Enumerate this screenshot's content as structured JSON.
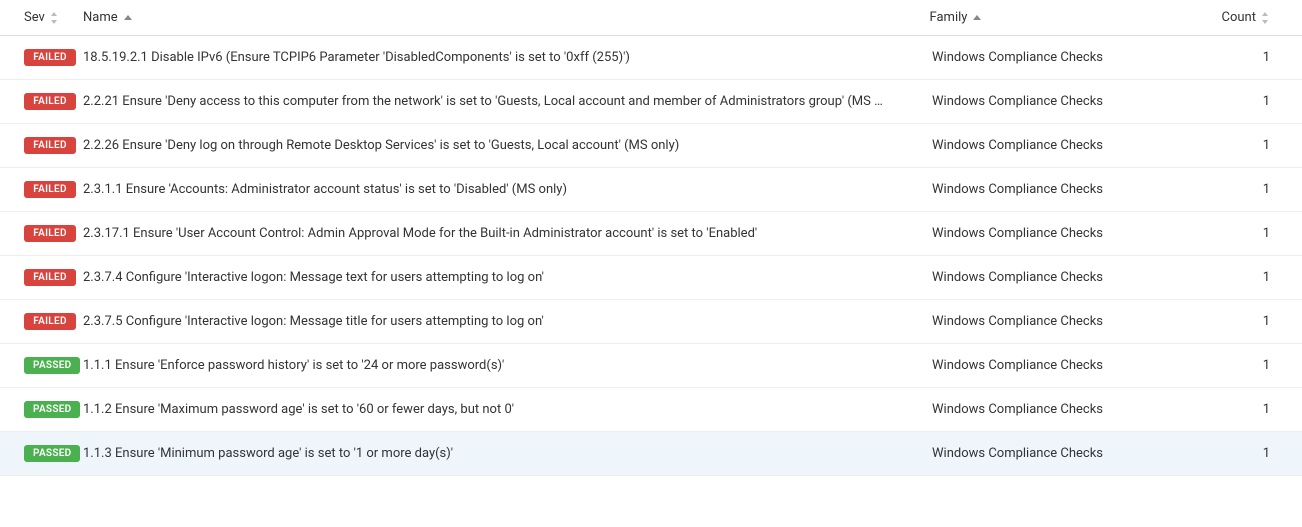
{
  "columns": {
    "sev": "Sev",
    "name": "Name",
    "family": "Family",
    "count": "Count"
  },
  "rows": [
    {
      "sev": "FAILED",
      "name": "18.5.19.2.1 Disable IPv6 (Ensure TCPIP6 Parameter 'DisabledComponents' is set to '0xff (255)')",
      "family": "Windows Compliance Checks",
      "count": "1"
    },
    {
      "sev": "FAILED",
      "name": "2.2.21 Ensure 'Deny access to this computer from the network' is set to 'Guests, Local account and member of Administrators group' (MS o...",
      "family": "Windows Compliance Checks",
      "count": "1"
    },
    {
      "sev": "FAILED",
      "name": "2.2.26 Ensure 'Deny log on through Remote Desktop Services' is set to 'Guests, Local account' (MS only)",
      "family": "Windows Compliance Checks",
      "count": "1"
    },
    {
      "sev": "FAILED",
      "name": "2.3.1.1 Ensure 'Accounts: Administrator account status' is set to 'Disabled' (MS only)",
      "family": "Windows Compliance Checks",
      "count": "1"
    },
    {
      "sev": "FAILED",
      "name": "2.3.17.1 Ensure 'User Account Control: Admin Approval Mode for the Built-in Administrator account' is set to 'Enabled'",
      "family": "Windows Compliance Checks",
      "count": "1"
    },
    {
      "sev": "FAILED",
      "name": "2.3.7.4 Configure 'Interactive logon: Message text for users attempting to log on'",
      "family": "Windows Compliance Checks",
      "count": "1"
    },
    {
      "sev": "FAILED",
      "name": "2.3.7.5 Configure 'Interactive logon: Message title for users attempting to log on'",
      "family": "Windows Compliance Checks",
      "count": "1"
    },
    {
      "sev": "PASSED",
      "name": "1.1.1 Ensure 'Enforce password history' is set to '24 or more password(s)'",
      "family": "Windows Compliance Checks",
      "count": "1"
    },
    {
      "sev": "PASSED",
      "name": "1.1.2 Ensure 'Maximum password age' is set to '60 or fewer days, but not 0'",
      "family": "Windows Compliance Checks",
      "count": "1"
    },
    {
      "sev": "PASSED",
      "name": "1.1.3 Ensure 'Minimum password age' is set to '1 or more day(s)'",
      "family": "Windows Compliance Checks",
      "count": "1",
      "hovered": true
    }
  ],
  "colors": {
    "failed": "#d9433e",
    "passed": "#4bb04f"
  }
}
